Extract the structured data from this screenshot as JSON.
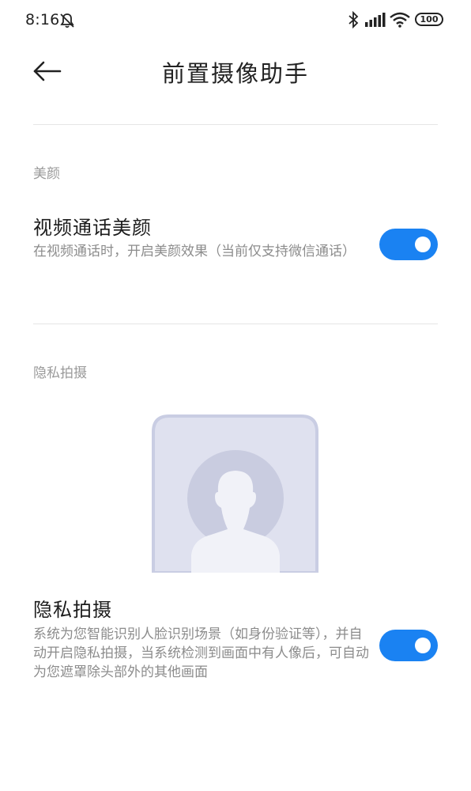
{
  "status_bar": {
    "time": "8:16",
    "battery": "100",
    "icons": [
      "mute-icon",
      "bluetooth-icon",
      "signal-icon",
      "wifi-icon",
      "battery-icon"
    ]
  },
  "header": {
    "back_icon": "arrow-left-icon",
    "title": "前置摄像助手"
  },
  "sections": {
    "beauty": {
      "label": "美颜",
      "setting": {
        "title": "视频通话美颜",
        "description": "在视频通话时，开启美颜效果（当前仅支持微信通话）",
        "enabled": true
      }
    },
    "privacy": {
      "label": "隐私拍摄",
      "illustration_icon": "person-silhouette-icon",
      "setting": {
        "title": "隐私拍摄",
        "description": "系统为您智能识别人脸识别场景（如身份验证等），并自动开启隐私拍摄，当系统检测到画面中有人像后，可自动为您遮罩除头部外的其他画面",
        "enabled": true
      }
    }
  },
  "colors": {
    "toggle_on": "#1a82f2",
    "illustration_frame": "#c9cde3",
    "illustration_fill": "#dfe1ef"
  }
}
